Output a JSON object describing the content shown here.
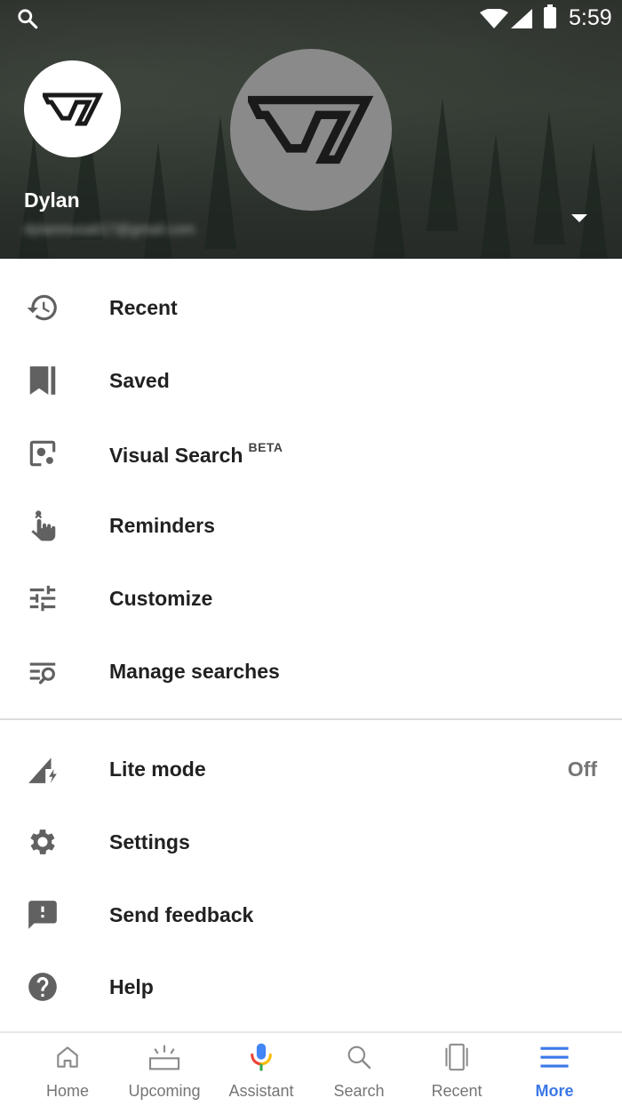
{
  "status_bar": {
    "time": "5:59",
    "icons": [
      "search-icon",
      "wifi-icon",
      "cell-signal-icon",
      "battery-icon"
    ]
  },
  "account": {
    "name": "Dylan",
    "email": "dylanmusati17@gmail.com"
  },
  "menu_primary": [
    {
      "label": "Recent",
      "icon": "history-icon"
    },
    {
      "label": "Saved",
      "icon": "bookmark-icon"
    },
    {
      "label": "Visual Search",
      "badge": "BETA",
      "icon": "visual-search-icon"
    },
    {
      "label": "Reminders",
      "icon": "reminder-hand-icon"
    },
    {
      "label": "Customize",
      "icon": "tune-icon"
    },
    {
      "label": "Manage searches",
      "icon": "manage-search-icon"
    }
  ],
  "menu_secondary": [
    {
      "label": "Lite mode",
      "value": "Off",
      "icon": "lite-signal-icon"
    },
    {
      "label": "Settings",
      "icon": "gear-icon"
    },
    {
      "label": "Send feedback",
      "icon": "feedback-icon"
    },
    {
      "label": "Help",
      "icon": "help-icon"
    }
  ],
  "bottom_nav": [
    {
      "label": "Home",
      "icon": "home-icon"
    },
    {
      "label": "Upcoming",
      "icon": "upcoming-icon"
    },
    {
      "label": "Assistant",
      "icon": "mic-icon"
    },
    {
      "label": "Search",
      "icon": "search-icon"
    },
    {
      "label": "Recent",
      "icon": "recent-cards-icon"
    },
    {
      "label": "More",
      "icon": "menu-icon",
      "active": true
    }
  ],
  "colors": {
    "accent": "#3b78e7",
    "text_primary": "#212121",
    "text_secondary": "#757575",
    "icon_gray": "#616161"
  }
}
